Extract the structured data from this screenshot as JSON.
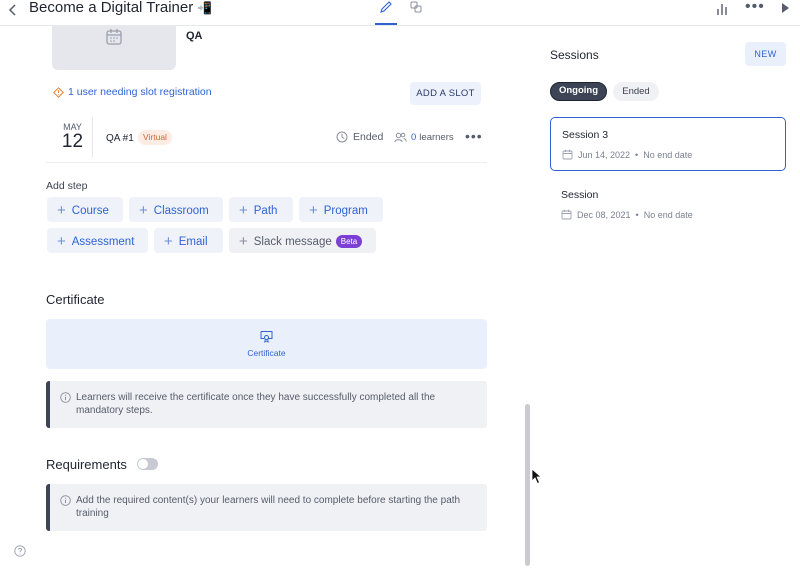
{
  "header": {
    "title": "Become a Digital Trainer",
    "title_emoji": "📲"
  },
  "path": {
    "step_title": "QA",
    "warning": "1 user needing slot registration",
    "add_slot_label": "ADD A SLOT",
    "slot": {
      "month": "MAY",
      "day": "12",
      "name": "QA #1",
      "type_badge": "Virtual",
      "status": "Ended",
      "learner_count": "0",
      "learners_label": "learners"
    },
    "add_step_label": "Add step",
    "step_types": [
      "Course",
      "Classroom",
      "Path",
      "Program",
      "Assessment",
      "Email",
      "Slack message"
    ],
    "beta_badge": "Beta"
  },
  "certificate": {
    "heading": "Certificate",
    "box_label": "Certificate",
    "info": "Learners will receive the certificate once they have successfully completed all the mandatory steps."
  },
  "requirements": {
    "heading": "Requirements",
    "enabled": false,
    "info": "Add the required content(s) your learners will need to complete before starting the path training"
  },
  "sessions": {
    "title": "Sessions",
    "new_label": "NEW",
    "filters": [
      "Ongoing",
      "Ended"
    ],
    "active_filter": "Ongoing",
    "items": [
      {
        "name": "Session 3",
        "start": "Jun 14, 2022",
        "end": "No end date",
        "selected": true
      },
      {
        "name": "Session",
        "start": "Dec 08, 2021",
        "end": "No end date",
        "selected": false
      }
    ],
    "separator": "•"
  },
  "colors": {
    "accent": "#2f63d3",
    "beta": "#7b3fd6",
    "virtual_badge": "#fcece3"
  }
}
